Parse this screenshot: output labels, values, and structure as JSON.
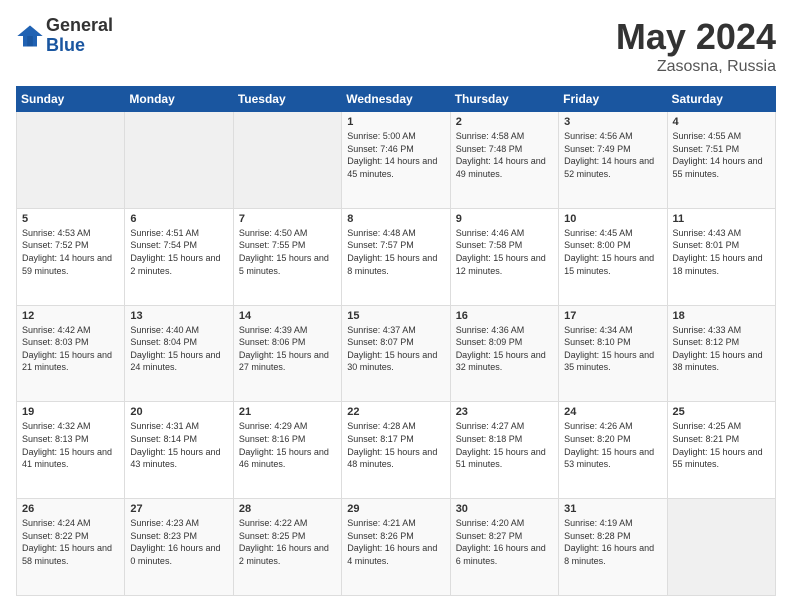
{
  "logo": {
    "general": "General",
    "blue": "Blue"
  },
  "title": {
    "month_year": "May 2024",
    "location": "Zasosna, Russia"
  },
  "weekdays": [
    "Sunday",
    "Monday",
    "Tuesday",
    "Wednesday",
    "Thursday",
    "Friday",
    "Saturday"
  ],
  "weeks": [
    [
      {
        "day": "",
        "sunrise": "",
        "sunset": "",
        "daylight": ""
      },
      {
        "day": "",
        "sunrise": "",
        "sunset": "",
        "daylight": ""
      },
      {
        "day": "",
        "sunrise": "",
        "sunset": "",
        "daylight": ""
      },
      {
        "day": "1",
        "sunrise": "Sunrise: 5:00 AM",
        "sunset": "Sunset: 7:46 PM",
        "daylight": "Daylight: 14 hours and 45 minutes."
      },
      {
        "day": "2",
        "sunrise": "Sunrise: 4:58 AM",
        "sunset": "Sunset: 7:48 PM",
        "daylight": "Daylight: 14 hours and 49 minutes."
      },
      {
        "day": "3",
        "sunrise": "Sunrise: 4:56 AM",
        "sunset": "Sunset: 7:49 PM",
        "daylight": "Daylight: 14 hours and 52 minutes."
      },
      {
        "day": "4",
        "sunrise": "Sunrise: 4:55 AM",
        "sunset": "Sunset: 7:51 PM",
        "daylight": "Daylight: 14 hours and 55 minutes."
      }
    ],
    [
      {
        "day": "5",
        "sunrise": "Sunrise: 4:53 AM",
        "sunset": "Sunset: 7:52 PM",
        "daylight": "Daylight: 14 hours and 59 minutes."
      },
      {
        "day": "6",
        "sunrise": "Sunrise: 4:51 AM",
        "sunset": "Sunset: 7:54 PM",
        "daylight": "Daylight: 15 hours and 2 minutes."
      },
      {
        "day": "7",
        "sunrise": "Sunrise: 4:50 AM",
        "sunset": "Sunset: 7:55 PM",
        "daylight": "Daylight: 15 hours and 5 minutes."
      },
      {
        "day": "8",
        "sunrise": "Sunrise: 4:48 AM",
        "sunset": "Sunset: 7:57 PM",
        "daylight": "Daylight: 15 hours and 8 minutes."
      },
      {
        "day": "9",
        "sunrise": "Sunrise: 4:46 AM",
        "sunset": "Sunset: 7:58 PM",
        "daylight": "Daylight: 15 hours and 12 minutes."
      },
      {
        "day": "10",
        "sunrise": "Sunrise: 4:45 AM",
        "sunset": "Sunset: 8:00 PM",
        "daylight": "Daylight: 15 hours and 15 minutes."
      },
      {
        "day": "11",
        "sunrise": "Sunrise: 4:43 AM",
        "sunset": "Sunset: 8:01 PM",
        "daylight": "Daylight: 15 hours and 18 minutes."
      }
    ],
    [
      {
        "day": "12",
        "sunrise": "Sunrise: 4:42 AM",
        "sunset": "Sunset: 8:03 PM",
        "daylight": "Daylight: 15 hours and 21 minutes."
      },
      {
        "day": "13",
        "sunrise": "Sunrise: 4:40 AM",
        "sunset": "Sunset: 8:04 PM",
        "daylight": "Daylight: 15 hours and 24 minutes."
      },
      {
        "day": "14",
        "sunrise": "Sunrise: 4:39 AM",
        "sunset": "Sunset: 8:06 PM",
        "daylight": "Daylight: 15 hours and 27 minutes."
      },
      {
        "day": "15",
        "sunrise": "Sunrise: 4:37 AM",
        "sunset": "Sunset: 8:07 PM",
        "daylight": "Daylight: 15 hours and 30 minutes."
      },
      {
        "day": "16",
        "sunrise": "Sunrise: 4:36 AM",
        "sunset": "Sunset: 8:09 PM",
        "daylight": "Daylight: 15 hours and 32 minutes."
      },
      {
        "day": "17",
        "sunrise": "Sunrise: 4:34 AM",
        "sunset": "Sunset: 8:10 PM",
        "daylight": "Daylight: 15 hours and 35 minutes."
      },
      {
        "day": "18",
        "sunrise": "Sunrise: 4:33 AM",
        "sunset": "Sunset: 8:12 PM",
        "daylight": "Daylight: 15 hours and 38 minutes."
      }
    ],
    [
      {
        "day": "19",
        "sunrise": "Sunrise: 4:32 AM",
        "sunset": "Sunset: 8:13 PM",
        "daylight": "Daylight: 15 hours and 41 minutes."
      },
      {
        "day": "20",
        "sunrise": "Sunrise: 4:31 AM",
        "sunset": "Sunset: 8:14 PM",
        "daylight": "Daylight: 15 hours and 43 minutes."
      },
      {
        "day": "21",
        "sunrise": "Sunrise: 4:29 AM",
        "sunset": "Sunset: 8:16 PM",
        "daylight": "Daylight: 15 hours and 46 minutes."
      },
      {
        "day": "22",
        "sunrise": "Sunrise: 4:28 AM",
        "sunset": "Sunset: 8:17 PM",
        "daylight": "Daylight: 15 hours and 48 minutes."
      },
      {
        "day": "23",
        "sunrise": "Sunrise: 4:27 AM",
        "sunset": "Sunset: 8:18 PM",
        "daylight": "Daylight: 15 hours and 51 minutes."
      },
      {
        "day": "24",
        "sunrise": "Sunrise: 4:26 AM",
        "sunset": "Sunset: 8:20 PM",
        "daylight": "Daylight: 15 hours and 53 minutes."
      },
      {
        "day": "25",
        "sunrise": "Sunrise: 4:25 AM",
        "sunset": "Sunset: 8:21 PM",
        "daylight": "Daylight: 15 hours and 55 minutes."
      }
    ],
    [
      {
        "day": "26",
        "sunrise": "Sunrise: 4:24 AM",
        "sunset": "Sunset: 8:22 PM",
        "daylight": "Daylight: 15 hours and 58 minutes."
      },
      {
        "day": "27",
        "sunrise": "Sunrise: 4:23 AM",
        "sunset": "Sunset: 8:23 PM",
        "daylight": "Daylight: 16 hours and 0 minutes."
      },
      {
        "day": "28",
        "sunrise": "Sunrise: 4:22 AM",
        "sunset": "Sunset: 8:25 PM",
        "daylight": "Daylight: 16 hours and 2 minutes."
      },
      {
        "day": "29",
        "sunrise": "Sunrise: 4:21 AM",
        "sunset": "Sunset: 8:26 PM",
        "daylight": "Daylight: 16 hours and 4 minutes."
      },
      {
        "day": "30",
        "sunrise": "Sunrise: 4:20 AM",
        "sunset": "Sunset: 8:27 PM",
        "daylight": "Daylight: 16 hours and 6 minutes."
      },
      {
        "day": "31",
        "sunrise": "Sunrise: 4:19 AM",
        "sunset": "Sunset: 8:28 PM",
        "daylight": "Daylight: 16 hours and 8 minutes."
      },
      {
        "day": "",
        "sunrise": "",
        "sunset": "",
        "daylight": ""
      }
    ]
  ]
}
